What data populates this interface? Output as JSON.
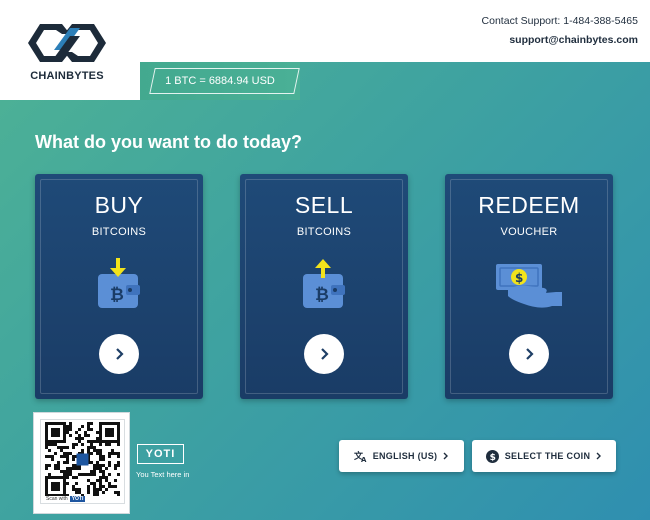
{
  "brand": {
    "name": "CHAINBYTES"
  },
  "rate": {
    "text": "1 BTC = 6884.94 USD"
  },
  "support": {
    "contact": "Contact Support: 1-484-388-5465",
    "email": "support@chainbytes.com"
  },
  "main": {
    "heading": "What do you want to do today?",
    "cards": [
      {
        "title": "BUY",
        "subtitle": "BITCOINS",
        "icon": "wallet-in-icon"
      },
      {
        "title": "SELL",
        "subtitle": "BITCOINS",
        "icon": "wallet-out-icon"
      },
      {
        "title": "REDEEM",
        "subtitle": "VOUCHER",
        "icon": "cash-hand-icon"
      }
    ]
  },
  "yoti": {
    "logo": "YOTI",
    "text": "You Text here in",
    "qr_caption_prefix": "Scan with",
    "qr_caption_brand": "YOTI"
  },
  "buttons": {
    "language": "ENGLISH (US)",
    "coin": "SELECT THE COIN"
  },
  "colors": {
    "card": "#1f4a78",
    "accent_yellow": "#f2e31b",
    "wallet_blue": "#5b8fd6",
    "text_dark": "#1f2d3d"
  }
}
